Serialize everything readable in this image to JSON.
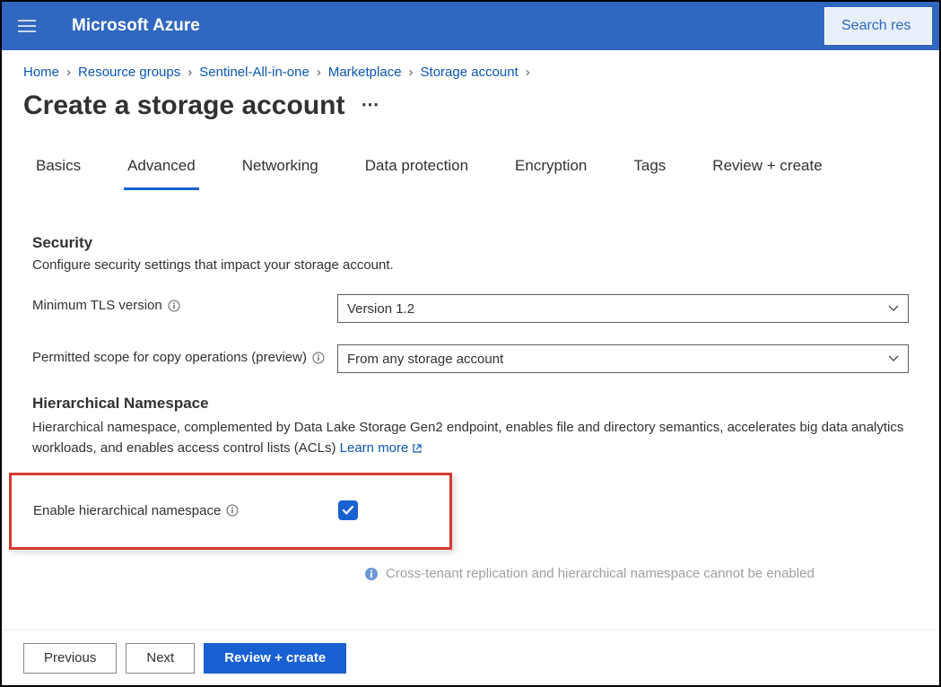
{
  "header": {
    "brand": "Microsoft Azure",
    "search_placeholder": "Search res"
  },
  "breadcrumb": [
    "Home",
    "Resource groups",
    "Sentinel-All-in-one",
    "Marketplace",
    "Storage account"
  ],
  "title": "Create a storage account",
  "tabs": [
    "Basics",
    "Advanced",
    "Networking",
    "Data protection",
    "Encryption",
    "Tags",
    "Review + create"
  ],
  "active_tab_index": 1,
  "security": {
    "heading": "Security",
    "description": "Configure security settings that impact your storage account.",
    "tls_label": "Minimum TLS version",
    "tls_value": "Version 1.2",
    "scope_label": "Permitted scope for copy operations (preview)",
    "scope_value": "From any storage account"
  },
  "hns": {
    "heading": "Hierarchical Namespace",
    "description": "Hierarchical namespace, complemented by Data Lake Storage Gen2 endpoint, enables file and directory semantics, accelerates big data analytics workloads, and enables access control lists (ACLs) ",
    "learn_more": "Learn more",
    "enable_label": "Enable hierarchical namespace",
    "enable_checked": true,
    "warning": "Cross-tenant replication and hierarchical namespace cannot be enabled"
  },
  "footer": {
    "previous": "Previous",
    "next": "Next",
    "review": "Review + create"
  }
}
